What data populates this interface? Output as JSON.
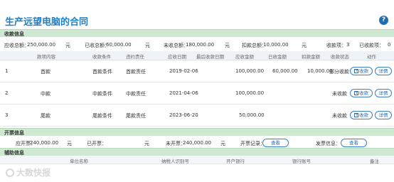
{
  "page": {
    "title": "生产远望电脑的合同",
    "help": "?"
  },
  "sections": {
    "collection": "收款信息",
    "invoice": "开票信息",
    "auxiliary": "辅助信息"
  },
  "summary": {
    "receivable_label": "应收总额：",
    "receivable_value": "250,000.00",
    "receivable_unit": "元",
    "received_label": "已收总额：",
    "received_value": "60,000.00",
    "received_unit": "元",
    "uncollected_label": "未收总额：",
    "uncollected_value": "180,000.00",
    "uncollected_unit": "元",
    "deduct_label": "扣款总额：",
    "deduct_value": "10,000.00",
    "deduct_unit": "元",
    "count_label": "收款项：",
    "count_value": "3",
    "done_label": "已收款项：",
    "done_value": "0"
  },
  "table": {
    "headers": [
      "款项内容",
      "收款条件",
      "违约责任",
      "应收日期",
      "最后收款日期",
      "应收金额",
      "已收金额",
      "扣款金额",
      "收款状态",
      "动作"
    ],
    "rows": [
      {
        "no": "1",
        "content": "首款",
        "condition": "首款条件",
        "liability": "首款责任",
        "due": "2019-02-06",
        "last": "",
        "amount": "100,000.00",
        "received": "60,000.00",
        "deduct": "10,000.00",
        "status": "部分收款",
        "collect": "收款",
        "detail": "详情"
      },
      {
        "no": "2",
        "content": "中款",
        "condition": "中款条件",
        "liability": "中款责任",
        "due": "2021-04-06",
        "last": "",
        "amount": "100,000.00",
        "received": "",
        "deduct": "",
        "status": "未收款",
        "collect": "收款",
        "detail": "详情"
      },
      {
        "no": "3",
        "content": "尾款",
        "condition": "尾款条件",
        "liability": "尾款责任",
        "due": "2023-06-20",
        "last": "",
        "amount": "50,000.00",
        "received": "",
        "deduct": "",
        "status": "未收款",
        "collect": "收款",
        "detail": "详情"
      }
    ]
  },
  "invoice": {
    "should_label": "应开票：",
    "should_value": "240,000.00",
    "should_unit": "元",
    "done_label": "已开票：",
    "done_value": "",
    "done_unit": "元",
    "pending_label": "未开票：",
    "pending_value": "240,000.00",
    "pending_unit": "元",
    "record_label": "开票记录：",
    "record_btn": "查看",
    "info_label": "发票信息：",
    "info_btn": "查看"
  },
  "auxiliary": {
    "headers": [
      "单位名称",
      "纳税人识别号",
      "开户银行",
      "银行账号",
      "备注"
    ]
  },
  "watermark": "大数快报"
}
